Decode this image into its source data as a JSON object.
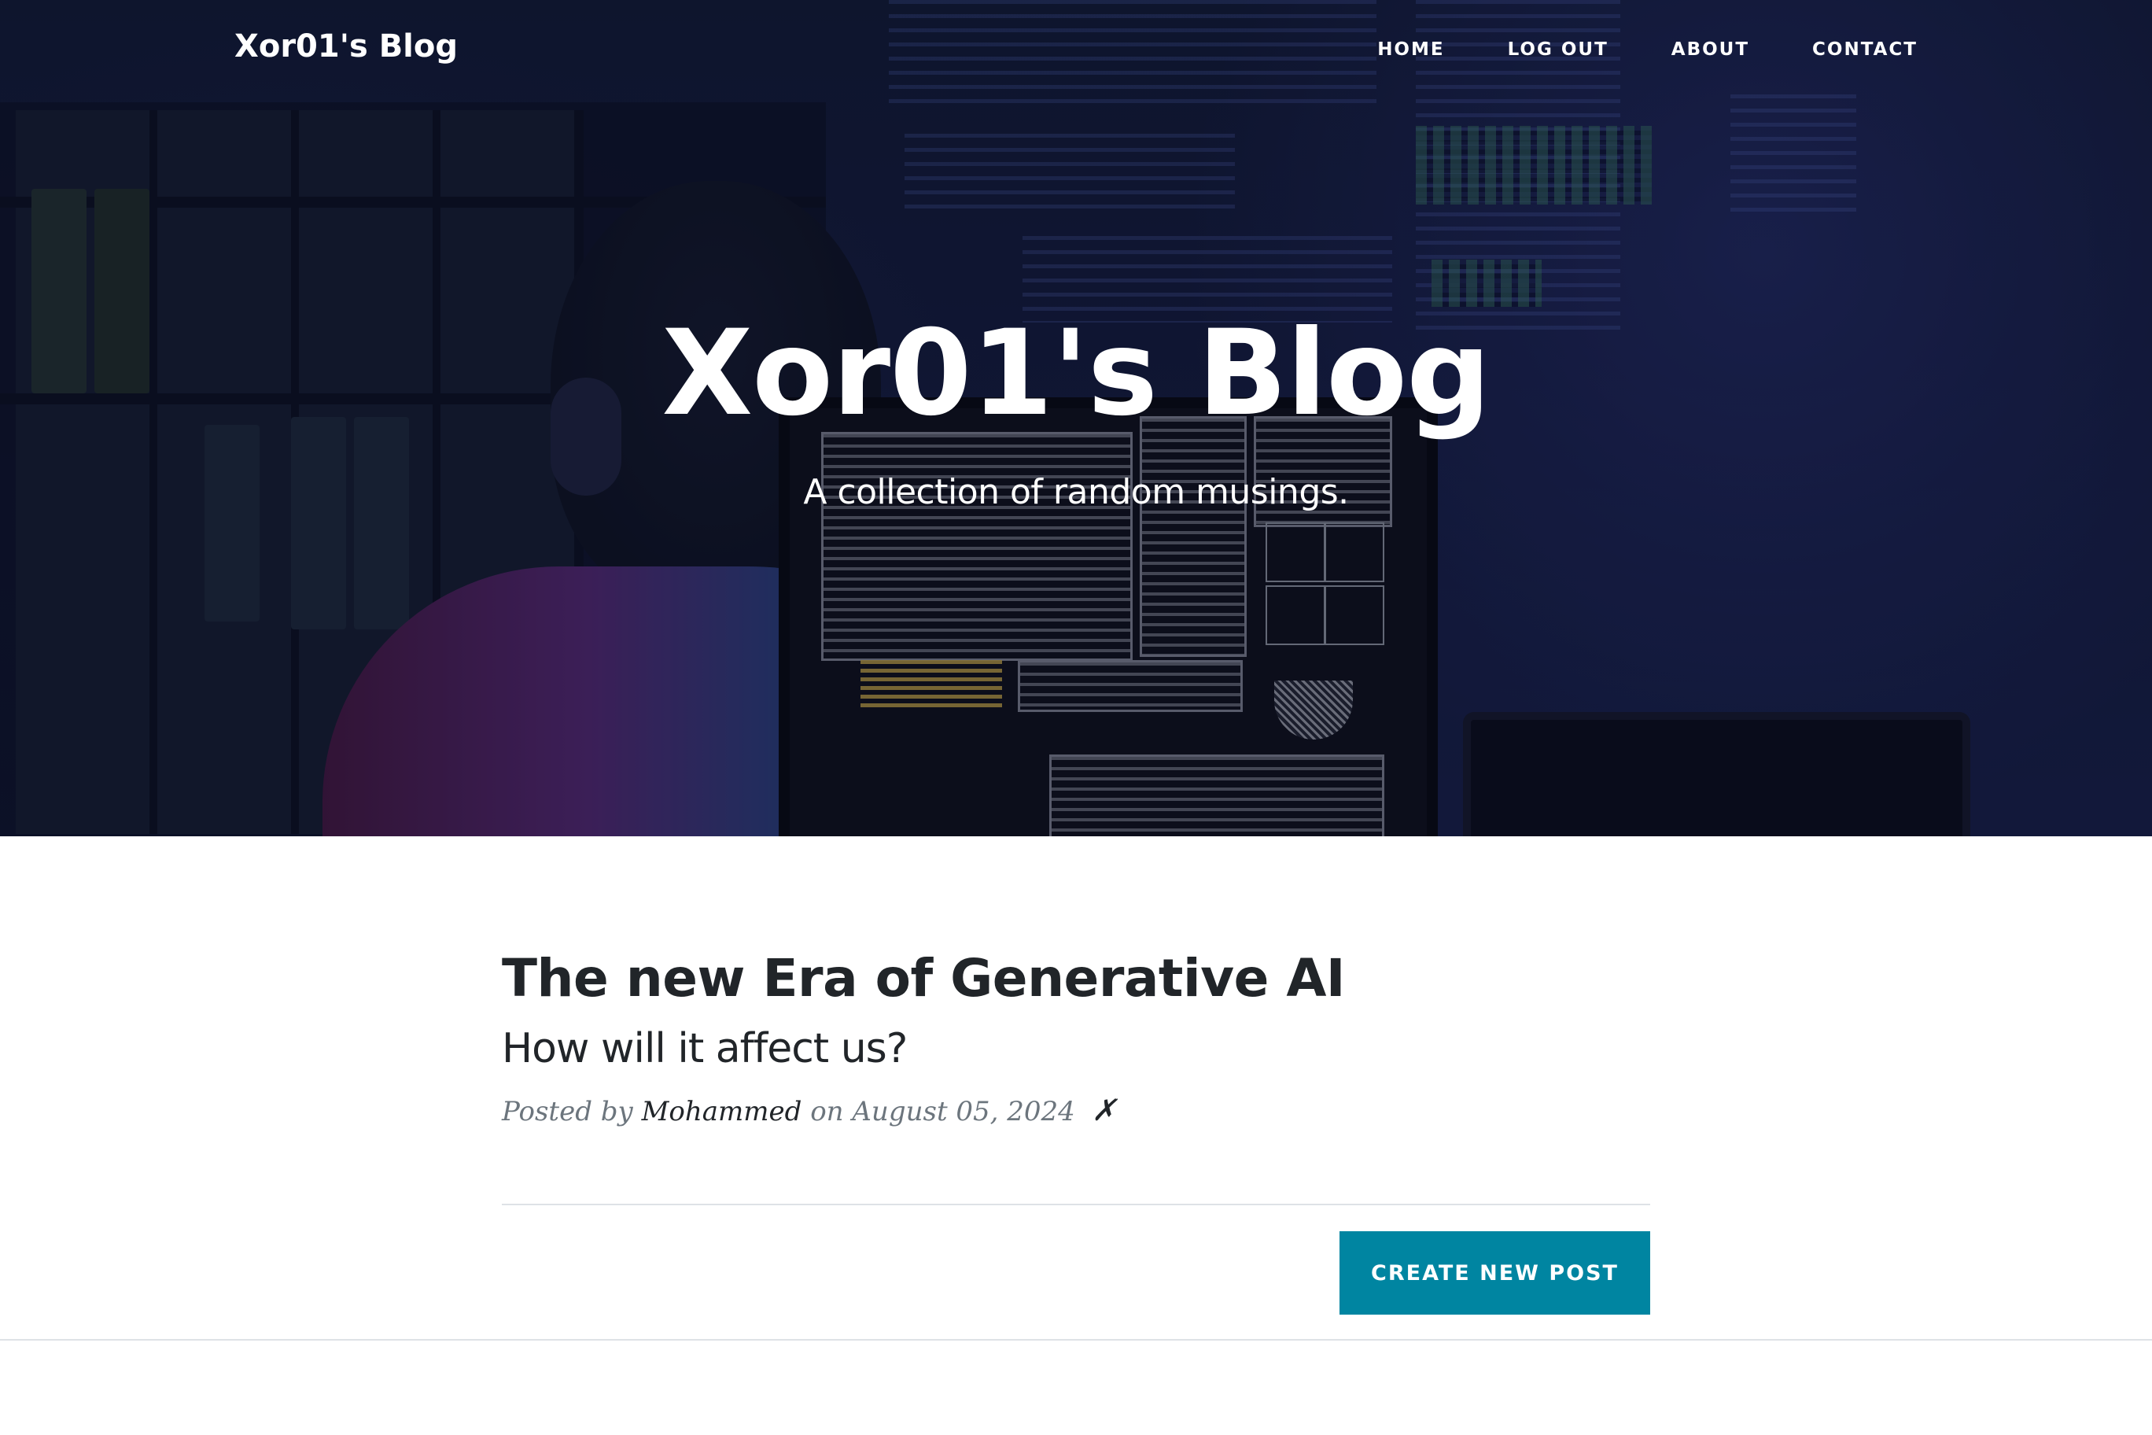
{
  "navbar": {
    "brand": "Xor01's Blog",
    "links": [
      "HOME",
      "LOG OUT",
      "ABOUT",
      "CONTACT"
    ]
  },
  "hero": {
    "title": "Xor01's Blog",
    "subtitle": "A collection of random musings."
  },
  "posts": [
    {
      "title": "The new Era of Generative AI",
      "subtitle": "How will it affect us?",
      "meta_prefix": "Posted by",
      "author": "Mohammed",
      "date_text": "on August 05, 2024",
      "delete_icon": "✗"
    }
  ],
  "actions": {
    "create_post_label": "CREATE NEW POST"
  },
  "colors": {
    "accent": "#0085a1",
    "text": "#212529",
    "muted": "#6c757d",
    "divider": "#dee2e6"
  }
}
